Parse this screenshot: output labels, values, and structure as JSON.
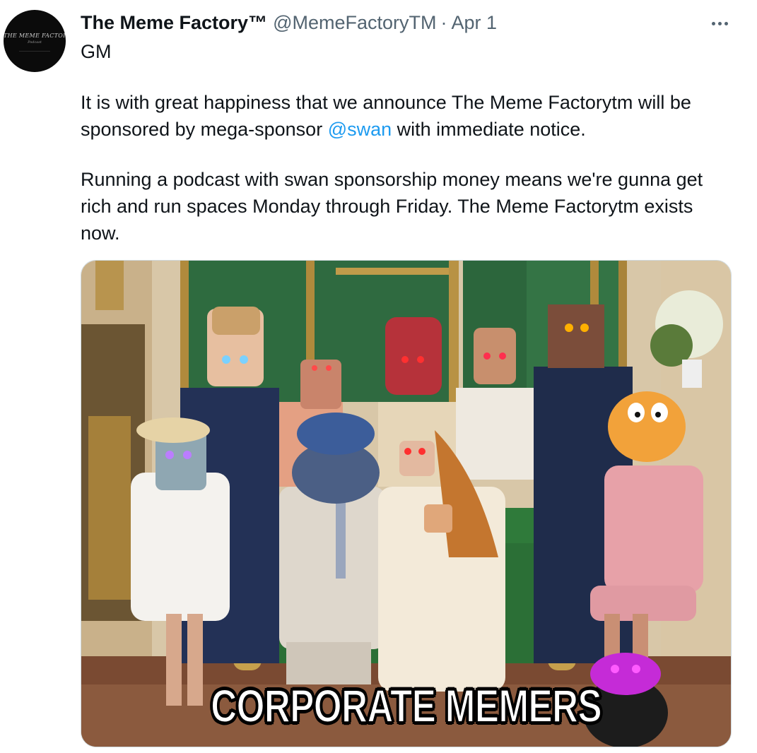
{
  "tweet": {
    "display_name": "The Meme Factory™",
    "handle": "@MemeFactoryTM",
    "separator": "·",
    "date": "Apr 1",
    "avatar_text": "THE MEME FACTORY™",
    "avatar_subtext": "Podcast",
    "more_icon": "more-horizontal-icon",
    "body": {
      "line1": "GM",
      "line2": "It is with great happiness that we announce The Meme Factorytm will be",
      "line3_before": "sponsored by mega-sponsor ",
      "line3_mention": "@swan",
      "line3_after": " with immediate notice.",
      "line4": "Running a podcast with swan sponsorship money means we're gunna get",
      "line5": "rich and run spaces Monday through Friday. The Meme Factorytm exists",
      "line6": "now."
    },
    "media": {
      "caption": "CORPORATE MEMERS"
    }
  },
  "colors": {
    "text": "#0f1419",
    "secondary": "#536471",
    "link": "#1d9bf0",
    "wall_green": "#2e6b3f",
    "gold": "#b08a3c"
  }
}
